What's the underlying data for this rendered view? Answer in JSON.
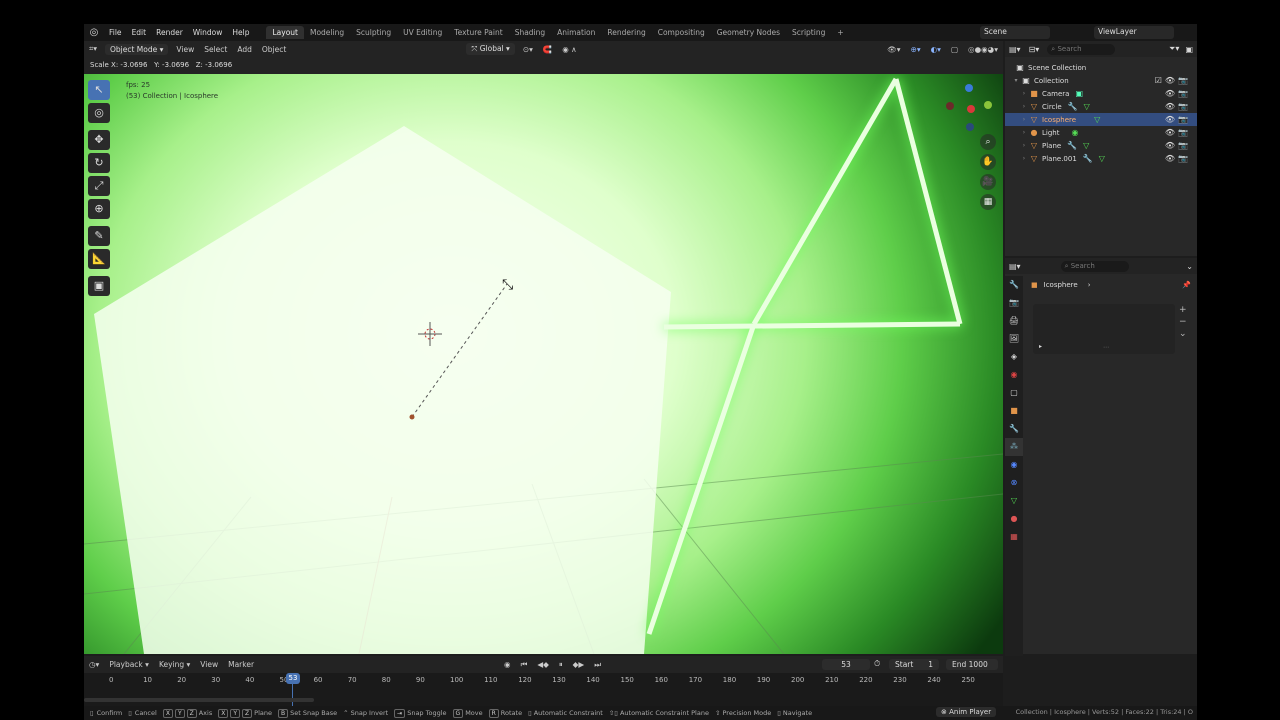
{
  "menu": [
    "File",
    "Edit",
    "Render",
    "Window",
    "Help"
  ],
  "workspaces": [
    "Layout",
    "Modeling",
    "Sculpting",
    "UV Editing",
    "Texture Paint",
    "Shading",
    "Animation",
    "Rendering",
    "Compositing",
    "Geometry Nodes",
    "Scripting"
  ],
  "active_workspace": "Layout",
  "scene": "Scene",
  "view_layer": "ViewLayer",
  "viewport_header": {
    "mode": "Object Mode",
    "menus": [
      "View",
      "Select",
      "Add",
      "Object"
    ],
    "orientation": "Global"
  },
  "operator_status": "Scale X: -3.0696   Y: -3.0696   Z: -3.0696",
  "viewport_info": {
    "fps": "fps: 25",
    "object": "(53) Collection | Icosphere"
  },
  "outliner": {
    "search_placeholder": "Search",
    "root": "Scene Collection",
    "collection": "Collection",
    "items": [
      {
        "name": "Camera",
        "icon": "camera-icon",
        "color": "#e0944a"
      },
      {
        "name": "Circle",
        "icon": "mesh-icon",
        "color": "#e0944a"
      },
      {
        "name": "Icosphere",
        "icon": "mesh-icon",
        "color": "#e0944a"
      },
      {
        "name": "Light",
        "icon": "light-icon",
        "color": "#e0944a"
      },
      {
        "name": "Plane",
        "icon": "mesh-icon",
        "color": "#e0944a"
      },
      {
        "name": "Plane.001",
        "icon": "mesh-icon",
        "color": "#e0944a"
      }
    ],
    "selected": "Icosphere"
  },
  "properties": {
    "search_placeholder": "Search",
    "object_name": "Icosphere"
  },
  "timeline": {
    "menus": [
      "Playback",
      "Keying",
      "View",
      "Marker"
    ],
    "current_frame": "53",
    "start_label": "Start",
    "start": "1",
    "end_label": "End",
    "end": "1000",
    "ticks": [
      "0",
      "10",
      "20",
      "30",
      "40",
      "50",
      "60",
      "70",
      "80",
      "90",
      "100",
      "110",
      "120",
      "130",
      "140",
      "150",
      "160",
      "170",
      "180",
      "190",
      "200",
      "210",
      "220",
      "230",
      "240",
      "250"
    ],
    "playhead": "53"
  },
  "statusbar": {
    "items": [
      "Confirm",
      "Cancel",
      "Axis",
      "Plane",
      "Set Snap Base",
      "Snap Invert",
      "Snap Toggle",
      "Move",
      "Rotate",
      "Automatic Constraint",
      "Automatic Constraint Plane",
      "Precision Mode",
      "Navigate"
    ],
    "keys_axis": [
      "X",
      "Y",
      "Z"
    ],
    "keys_plane": [
      "X",
      "Y",
      "Z"
    ],
    "key_snap": "B",
    "key_move": "G",
    "key_rotate": "R",
    "anim_player": "Anim Player",
    "stats": "Collection | Icosphere | Verts:52 | Faces:22 | Tris:24 | O"
  },
  "colors": {
    "accent": "#4772b3",
    "selection": "#334d80",
    "glow": "#6dff5a"
  }
}
